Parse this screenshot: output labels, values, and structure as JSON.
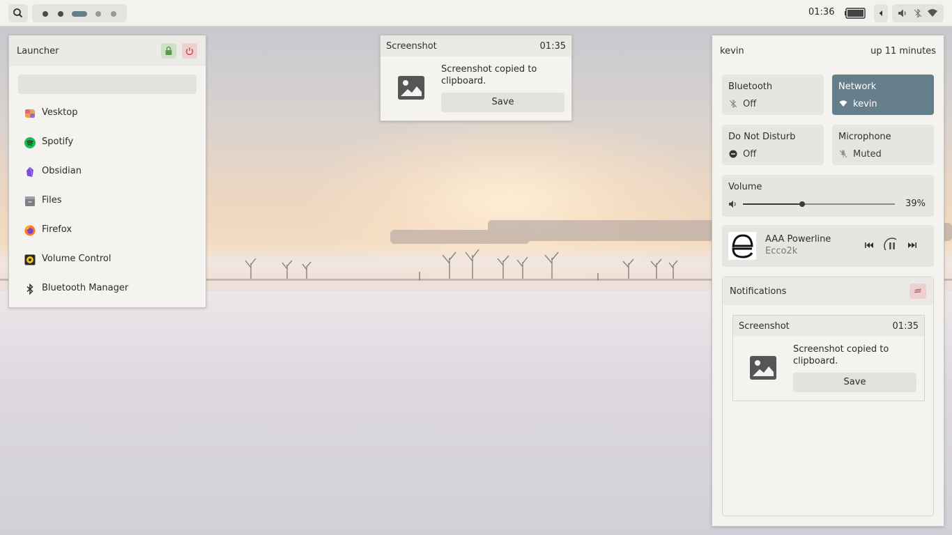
{
  "topbar": {
    "clock": "01:36",
    "workspaces": [
      "ws1",
      "ws2",
      "ws3",
      "ws4",
      "ws5"
    ],
    "active_workspace_index": 2,
    "icons": [
      "search-icon",
      "battery-icon",
      "chevron-left-icon",
      "volume-icon",
      "bluetooth-off-icon",
      "wifi-icon"
    ]
  },
  "launcher": {
    "title": "Launcher",
    "search": {
      "value": "",
      "placeholder": ""
    },
    "apps": [
      {
        "label": "Vesktop",
        "icon": "vesktop-icon"
      },
      {
        "label": "Spotify",
        "icon": "spotify-icon"
      },
      {
        "label": "Obsidian",
        "icon": "obsidian-icon"
      },
      {
        "label": "Files",
        "icon": "files-icon"
      },
      {
        "label": "Firefox",
        "icon": "firefox-icon"
      },
      {
        "label": "Volume Control",
        "icon": "volume-control-icon"
      },
      {
        "label": "Bluetooth Manager",
        "icon": "bluetooth-icon"
      }
    ],
    "lock_icon": "lock-icon",
    "power_icon": "power-icon"
  },
  "popup_notification": {
    "app": "Screenshot",
    "time": "01:35",
    "message": "Screenshot copied to clipboard.",
    "action": "Save"
  },
  "quick_settings": {
    "user": "kevin",
    "uptime": "up 11 minutes",
    "tiles": {
      "bluetooth": {
        "title": "Bluetooth",
        "status": "Off",
        "active": false
      },
      "network": {
        "title": "Network",
        "status": "kevin",
        "active": true
      },
      "dnd": {
        "title": "Do Not Disturb",
        "status": "Off",
        "active": false
      },
      "microphone": {
        "title": "Microphone",
        "status": "Muted",
        "active": false
      }
    },
    "volume": {
      "title": "Volume",
      "percent_label": "39%",
      "level": 0.39
    },
    "media": {
      "title": "AAA Powerline",
      "artist": "Ecco2k",
      "playing": true
    },
    "notifications": {
      "title": "Notifications",
      "items": [
        {
          "app": "Screenshot",
          "time": "01:35",
          "message": "Screenshot copied to clipboard.",
          "action": "Save"
        }
      ]
    }
  },
  "colors": {
    "accent": "#657f8a",
    "panel": "#f4f3f0",
    "danger_soft": "#eed0d0",
    "ok_soft": "#cfe1c8"
  }
}
